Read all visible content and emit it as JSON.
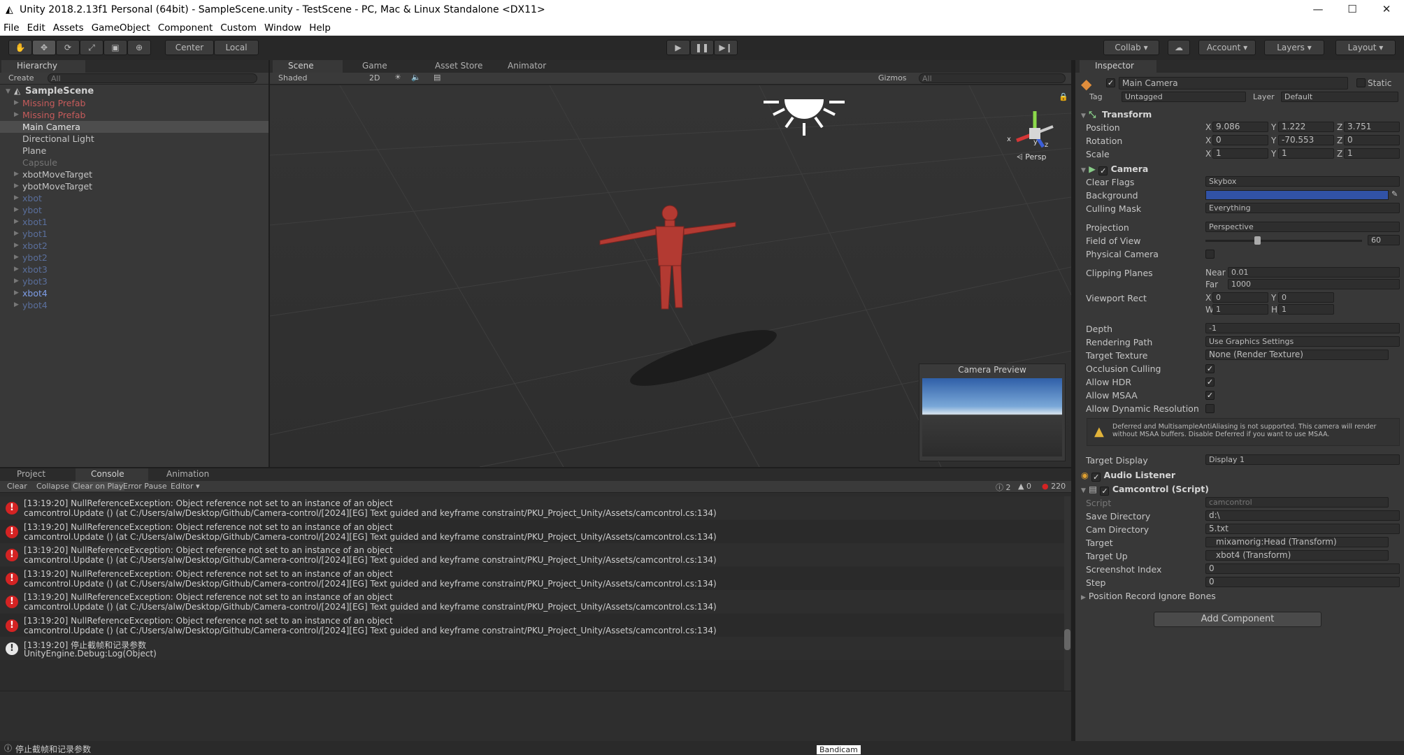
{
  "window": {
    "title": "Unity 2018.2.13f1 Personal (64bit) - SampleScene.unity - TestScene - PC, Mac & Linux Standalone <DX11>",
    "minimize": "—",
    "maximize": "☐",
    "close": "✕"
  },
  "menu": [
    "File",
    "Edit",
    "Assets",
    "GameObject",
    "Component",
    "Custom",
    "Window",
    "Help"
  ],
  "toolbar": {
    "center": "Center",
    "local": "Local",
    "collab": "Collab",
    "account": "Account",
    "layers": "Layers",
    "layout": "Layout"
  },
  "hierarchy": {
    "tab": "Hierarchy",
    "create": "Create",
    "search": "All",
    "scene": "SampleScene",
    "items": [
      {
        "label": "Missing Prefab",
        "style": "red",
        "arrow": true
      },
      {
        "label": "Missing Prefab",
        "style": "red",
        "arrow": true
      },
      {
        "label": "Main Camera",
        "style": "selected",
        "arrow": false
      },
      {
        "label": "Directional Light",
        "style": "normal",
        "arrow": false
      },
      {
        "label": "Plane",
        "style": "normal",
        "arrow": false
      },
      {
        "label": "Capsule",
        "style": "gray",
        "arrow": false
      },
      {
        "label": "xbotMoveTarget",
        "style": "normal",
        "arrow": true
      },
      {
        "label": "ybotMoveTarget",
        "style": "normal",
        "arrow": true
      },
      {
        "label": "xbot",
        "style": "dimblue",
        "arrow": true
      },
      {
        "label": "ybot",
        "style": "dimblue",
        "arrow": true
      },
      {
        "label": "xbot1",
        "style": "dimblue",
        "arrow": true
      },
      {
        "label": "ybot1",
        "style": "dimblue",
        "arrow": true
      },
      {
        "label": "xbot2",
        "style": "dimblue",
        "arrow": true
      },
      {
        "label": "ybot2",
        "style": "dimblue",
        "arrow": true
      },
      {
        "label": "xbot3",
        "style": "dimblue",
        "arrow": true
      },
      {
        "label": "ybot3",
        "style": "dimblue",
        "arrow": true
      },
      {
        "label": "xbot4",
        "style": "blue",
        "arrow": true
      },
      {
        "label": "ybot4",
        "style": "dimblue",
        "arrow": true
      }
    ]
  },
  "scene_tabs": [
    "Scene",
    "Game",
    "Asset Store",
    "Animator"
  ],
  "scene_toolbar": {
    "shaded": "Shaded",
    "mode2d": "2D",
    "gizmos": "Gizmos",
    "search": "All"
  },
  "gizmo": {
    "y": "y",
    "x": "x",
    "z": "z",
    "persp": "Persp"
  },
  "camera_preview": {
    "title": "Camera Preview"
  },
  "bottom_tabs": [
    "Project",
    "Console",
    "Animation"
  ],
  "console_toolbar": {
    "clear": "Clear",
    "collapse": "Collapse",
    "clear_on_play": "Clear on Play",
    "error_pause": "Error Pause",
    "editor": "Editor",
    "count_info": "2",
    "count_warn": "0",
    "count_error": "220"
  },
  "console_rows": [
    {
      "type": "error",
      "line1": "[13:19:20] NullReferenceException: Object reference not set to an instance of an object",
      "line2": "camcontrol.Update () (at C:/Users/alw/Desktop/Github/Camera-control/[2024][EG] Text guided and keyframe constraint/PKU_Project_Unity/Assets/camcontrol.cs:134)"
    },
    {
      "type": "error",
      "line1": "[13:19:20] NullReferenceException: Object reference not set to an instance of an object",
      "line2": "camcontrol.Update () (at C:/Users/alw/Desktop/Github/Camera-control/[2024][EG] Text guided and keyframe constraint/PKU_Project_Unity/Assets/camcontrol.cs:134)"
    },
    {
      "type": "error",
      "line1": "[13:19:20] NullReferenceException: Object reference not set to an instance of an object",
      "line2": "camcontrol.Update () (at C:/Users/alw/Desktop/Github/Camera-control/[2024][EG] Text guided and keyframe constraint/PKU_Project_Unity/Assets/camcontrol.cs:134)"
    },
    {
      "type": "error",
      "line1": "[13:19:20] NullReferenceException: Object reference not set to an instance of an object",
      "line2": "camcontrol.Update () (at C:/Users/alw/Desktop/Github/Camera-control/[2024][EG] Text guided and keyframe constraint/PKU_Project_Unity/Assets/camcontrol.cs:134)"
    },
    {
      "type": "error",
      "line1": "[13:19:20] NullReferenceException: Object reference not set to an instance of an object",
      "line2": "camcontrol.Update () (at C:/Users/alw/Desktop/Github/Camera-control/[2024][EG] Text guided and keyframe constraint/PKU_Project_Unity/Assets/camcontrol.cs:134)"
    },
    {
      "type": "error",
      "line1": "[13:19:20] NullReferenceException: Object reference not set to an instance of an object",
      "line2": "camcontrol.Update () (at C:/Users/alw/Desktop/Github/Camera-control/[2024][EG] Text guided and keyframe constraint/PKU_Project_Unity/Assets/camcontrol.cs:134)"
    },
    {
      "type": "info",
      "line1": "[13:19:20] 停止截帧和记录参数",
      "line2": "UnityEngine.Debug:Log(Object)"
    }
  ],
  "status_bar": {
    "message": "停止截帧和记录参数",
    "watermark": "Bandicam"
  },
  "inspector": {
    "tab": "Inspector",
    "object_name": "Main Camera",
    "static": "Static",
    "tag_label": "Tag",
    "tag": "Untagged",
    "layer_label": "Layer",
    "layer": "Default",
    "transform": {
      "title": "Transform",
      "position_label": "Position",
      "pos_x": "9.086",
      "pos_y": "1.222",
      "pos_z": "3.751",
      "rotation_label": "Rotation",
      "rot_x": "0",
      "rot_y": "-70.553",
      "rot_z": "0",
      "scale_label": "Scale",
      "sc_x": "1",
      "sc_y": "1",
      "sc_z": "1"
    },
    "camera": {
      "title": "Camera",
      "clear_flags_label": "Clear Flags",
      "clear_flags": "Skybox",
      "background_label": "Background",
      "culling_mask_label": "Culling Mask",
      "culling_mask": "Everything",
      "projection_label": "Projection",
      "projection": "Perspective",
      "fov_label": "Field of View",
      "fov": "60",
      "physical_label": "Physical Camera",
      "clipping_label": "Clipping Planes",
      "near_label": "Near",
      "near": "0.01",
      "far_label": "Far",
      "far": "1000",
      "viewport_label": "Viewport Rect",
      "vx": "0",
      "vy": "0",
      "vw": "1",
      "vh": "1",
      "depth_label": "Depth",
      "depth": "-1",
      "rendering_label": "Rendering Path",
      "rendering": "Use Graphics Settings",
      "target_texture_label": "Target Texture",
      "target_texture": "None (Render Texture)",
      "occlusion_label": "Occlusion Culling",
      "hdr_label": "Allow HDR",
      "msaa_label": "Allow MSAA",
      "dynres_label": "Allow Dynamic Resolution",
      "warning": "Deferred and MultisampleAntiAliasing is not supported. This camera will render without MSAA buffers. Disable Deferred if you want to use MSAA.",
      "target_display_label": "Target Display",
      "target_display": "Display 1"
    },
    "audio_listener": {
      "title": "Audio Listener"
    },
    "camcontrol": {
      "title": "Camcontrol (Script)",
      "script_label": "Script",
      "script": "camcontrol",
      "save_dir_label": "Save Directory",
      "save_dir": "d:\\",
      "cam_dir_label": "Cam Directory",
      "cam_dir": "5.txt",
      "target_label": "Target",
      "target": "mixamorig:Head (Transform)",
      "target_up_label": "Target Up",
      "target_up": "xbot4 (Transform)",
      "screenshot_label": "Screenshot Index",
      "screenshot": "0",
      "step_label": "Step",
      "step": "0",
      "ignore_label": "Position Record Ignore Bones"
    },
    "add_component": "Add Component"
  }
}
